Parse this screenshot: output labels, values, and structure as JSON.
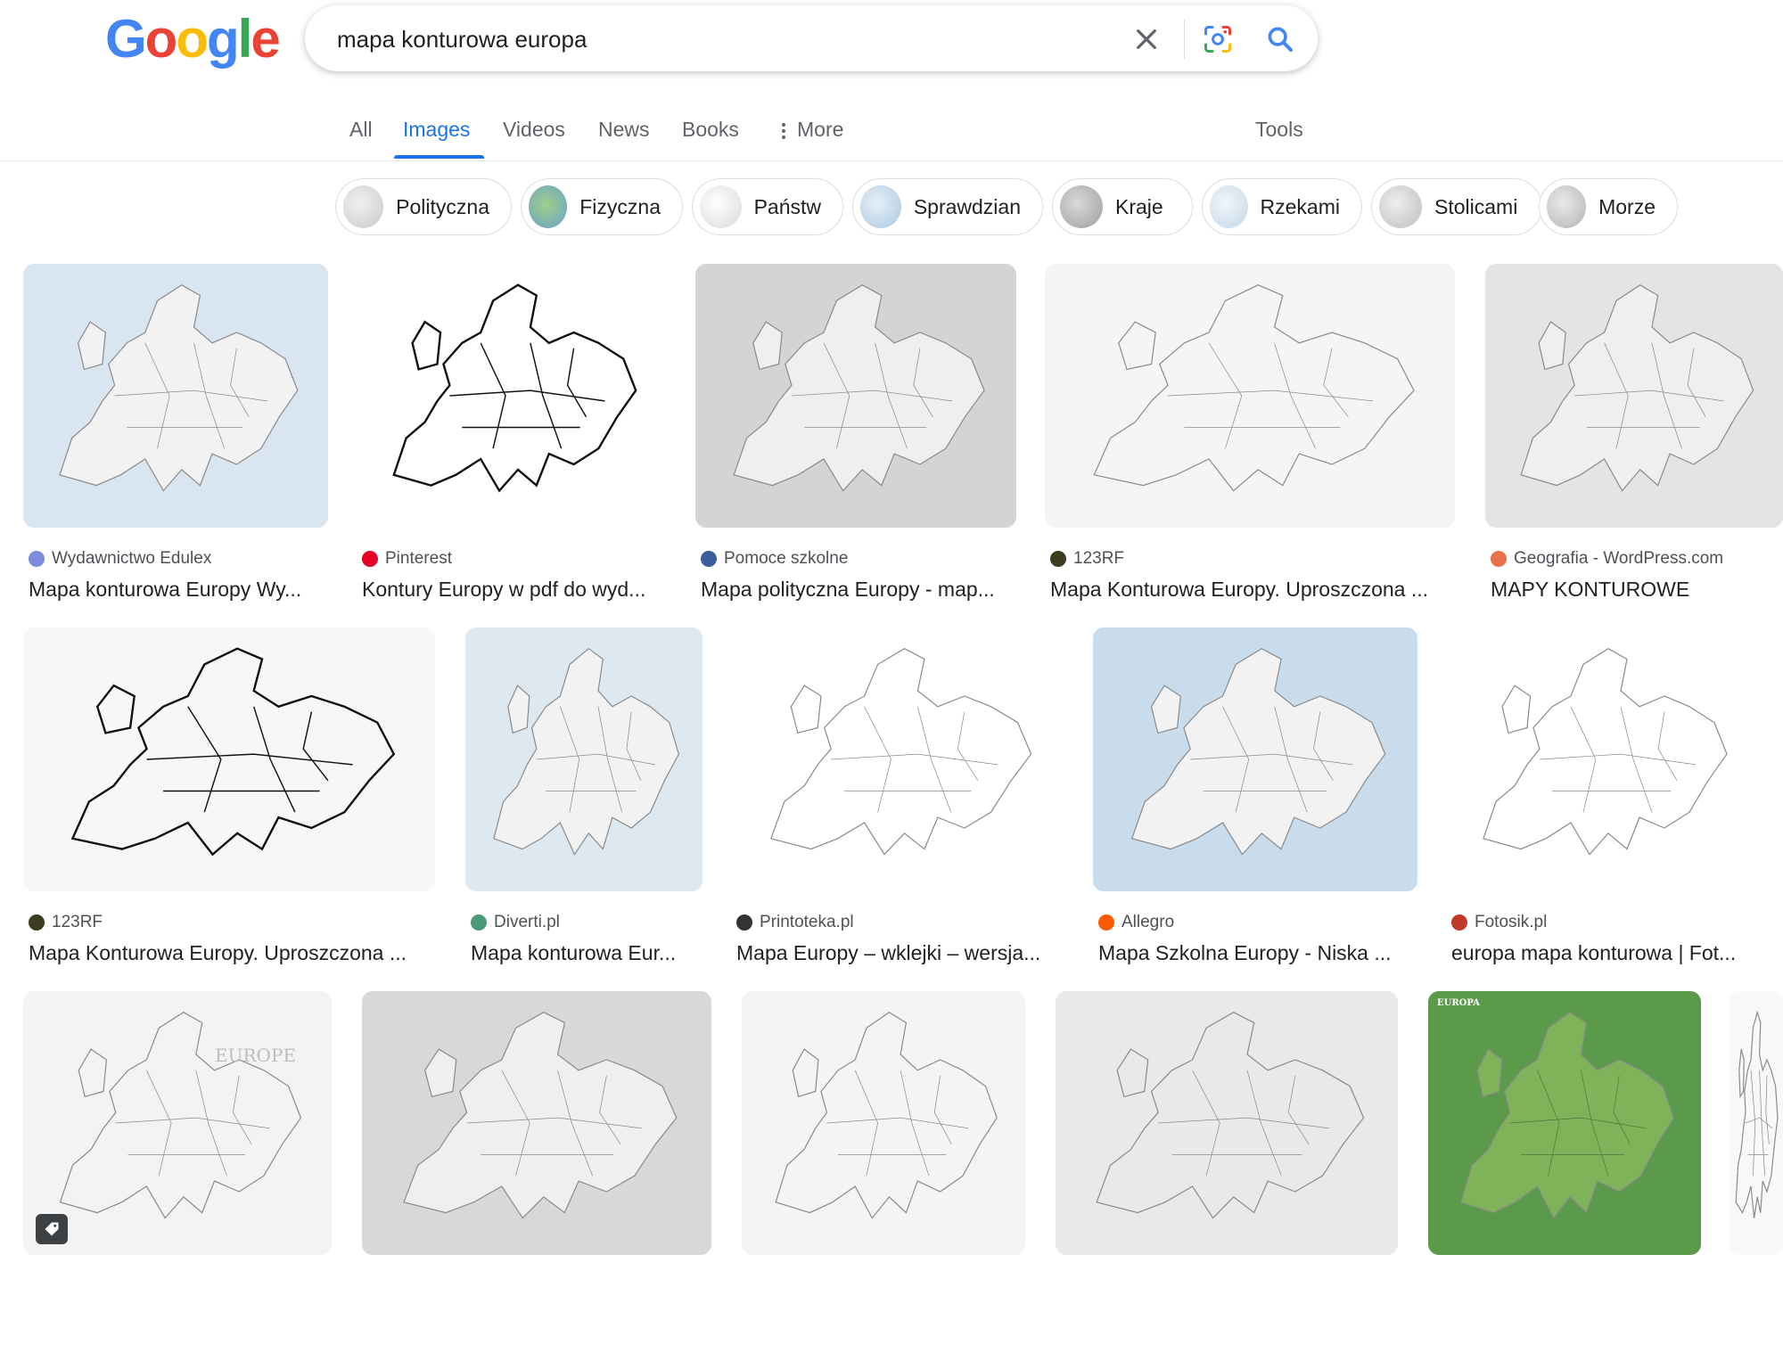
{
  "logo": [
    "G",
    "o",
    "o",
    "g",
    "l",
    "e"
  ],
  "search": {
    "query": "mapa konturowa europa"
  },
  "tabs": [
    {
      "label": "All",
      "active": false
    },
    {
      "label": "Images",
      "active": true
    },
    {
      "label": "Videos",
      "active": false
    },
    {
      "label": "News",
      "active": false
    },
    {
      "label": "Books",
      "active": false
    },
    {
      "label": "More",
      "active": false
    },
    {
      "label": "Tools",
      "active": false
    }
  ],
  "chips": [
    {
      "label": "Polityczna"
    },
    {
      "label": "Fizyczna"
    },
    {
      "label": "Państw"
    },
    {
      "label": "Sprawdzian"
    },
    {
      "label": "Kraje"
    },
    {
      "label": "Rzekami"
    },
    {
      "label": "Stolicami"
    },
    {
      "label": "Morze"
    }
  ],
  "results": [
    {
      "source": "Wydawnictwo Edulex",
      "title": "Mapa konturowa Europy Wy...",
      "favicon": "edulex-icon",
      "favicon_color": "#7b8cde",
      "bg": "#d9e6f2"
    },
    {
      "source": "Pinterest",
      "title": "Kontury Europy w pdf do wyd...",
      "favicon": "pinterest-icon",
      "favicon_color": "#e60023",
      "bg": "#ffffff"
    },
    {
      "source": "Pomoce szkolne",
      "title": "Mapa polityczna Europy - map...",
      "favicon": "globe-icon",
      "favicon_color": "#3a5d9c",
      "bg": "#d4d4d4"
    },
    {
      "source": "123RF",
      "title": "Mapa Konturowa Europy. Uproszczona ...",
      "favicon": "123rf-icon",
      "favicon_color": "#3c3c1e",
      "bg": "#f5f5f5"
    },
    {
      "source": "Geografia - WordPress.com",
      "title": "MAPY KONTUROWE",
      "favicon": "geografia-icon",
      "favicon_color": "#e8734a",
      "bg": "#e4e4e4"
    },
    {
      "source": "123RF",
      "title": "Mapa Konturowa Europy. Uproszczona ...",
      "favicon": "123rf-icon",
      "favicon_color": "#3c3c1e",
      "bg": "#f7f7f7"
    },
    {
      "source": "Diverti.pl",
      "title": "Mapa konturowa Eur...",
      "favicon": "diverti-icon",
      "favicon_color": "#4a9a7a",
      "bg": "#dde8f0"
    },
    {
      "source": "Printoteka.pl",
      "title": "Mapa Europy – wklejki – wersja...",
      "favicon": "printoteka-icon",
      "favicon_color": "#333333",
      "bg": "#ffffff"
    },
    {
      "source": "Allegro",
      "title": "Mapa Szkolna Europy - Niska ...",
      "favicon": "allegro-icon",
      "favicon_color": "#ff5a00",
      "bg": "#c9dceb"
    },
    {
      "source": "Fotosik.pl",
      "title": "europa mapa konturowa | Fot...",
      "favicon": "fotosik-icon",
      "favicon_color": "#c0392b",
      "bg": "#ffffff"
    },
    {
      "source": "",
      "title": "",
      "favicon": "",
      "favicon_color": "",
      "bg": "#f3f3f3",
      "overlay_text": "EUROPE"
    },
    {
      "source": "",
      "title": "",
      "favicon": "",
      "favicon_color": "",
      "bg": "#d8d8d8"
    },
    {
      "source": "",
      "title": "",
      "favicon": "",
      "favicon_color": "",
      "bg": "#f4f4f4"
    },
    {
      "source": "",
      "title": "",
      "favicon": "",
      "favicon_color": "",
      "bg": "#e9e9e9"
    },
    {
      "source": "",
      "title": "",
      "favicon": "",
      "favicon_color": "",
      "bg": "#5a9a4a",
      "overlay_text": "EUROPA"
    },
    {
      "source": "",
      "title": "",
      "favicon": "",
      "favicon_color": "",
      "bg": "#f8f8f8"
    }
  ]
}
